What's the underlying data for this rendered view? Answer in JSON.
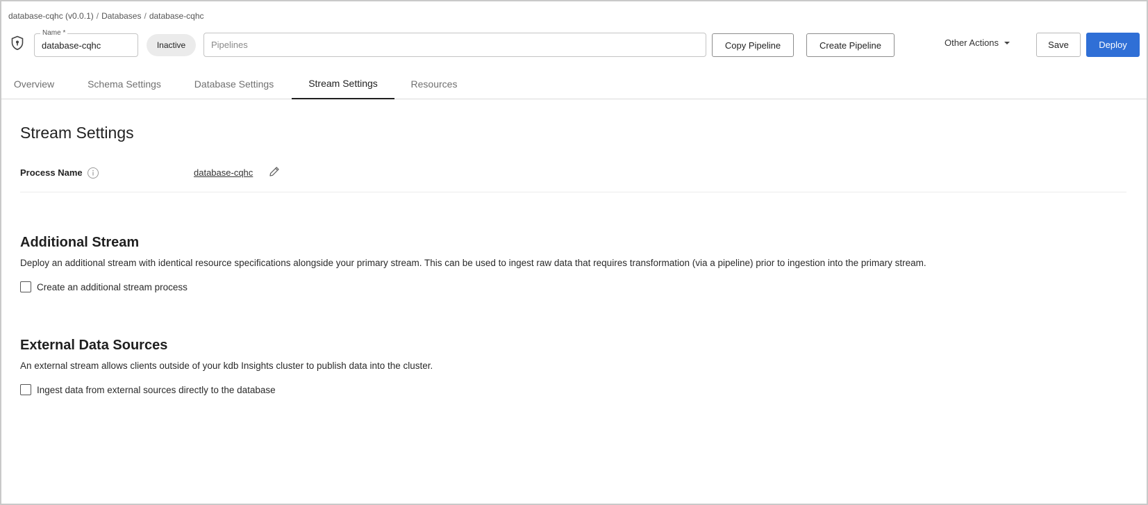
{
  "breadcrumb": {
    "items": [
      "database-cqhc (v0.0.1)",
      "Databases",
      "database-cqhc"
    ],
    "separator": "/"
  },
  "header": {
    "shield_icon": "shield-lock-icon",
    "name_label": "Name *",
    "name_value": "database-cqhc",
    "status": "Inactive",
    "pipelines_placeholder": "Pipelines",
    "copy_pipeline_label": "Copy Pipeline",
    "create_pipeline_label": "Create Pipeline",
    "other_actions_label": "Other Actions",
    "save_label": "Save",
    "deploy_label": "Deploy",
    "accent_color": "#2f6fd6"
  },
  "tabs": [
    {
      "label": "Overview",
      "active": false
    },
    {
      "label": "Schema Settings",
      "active": false
    },
    {
      "label": "Database Settings",
      "active": false
    },
    {
      "label": "Stream Settings",
      "active": true
    },
    {
      "label": "Resources",
      "active": false
    }
  ],
  "main": {
    "title": "Stream Settings",
    "process_name_label": "Process Name",
    "process_name_value": "database-cqhc",
    "additional_stream": {
      "title": "Additional Stream",
      "description": "Deploy an additional stream with identical resource specifications alongside your primary stream. This can be used to ingest raw data that requires transformation (via a pipeline) prior to ingestion into the primary stream.",
      "checkbox_label": "Create an additional stream process",
      "checked": false
    },
    "external_data_sources": {
      "title": "External Data Sources",
      "description": "An external stream allows clients outside of your kdb Insights cluster to publish data into the cluster.",
      "checkbox_label": "Ingest data from external sources directly to the database",
      "checked": false
    }
  }
}
